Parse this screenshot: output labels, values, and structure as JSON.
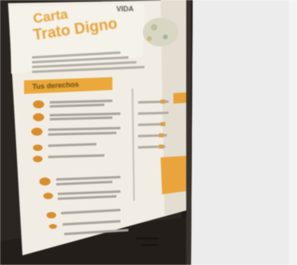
{
  "poster": {
    "brand": "VIDA",
    "title_line1": "Carta",
    "title_line2": "Trato Digno",
    "section_label": "Tus derechos"
  },
  "colors": {
    "poster_orange": "#e6a33a",
    "poster_paper": "#f2efe8",
    "wall_white": "#f7f7f7",
    "door_frame": "#2b2622"
  }
}
